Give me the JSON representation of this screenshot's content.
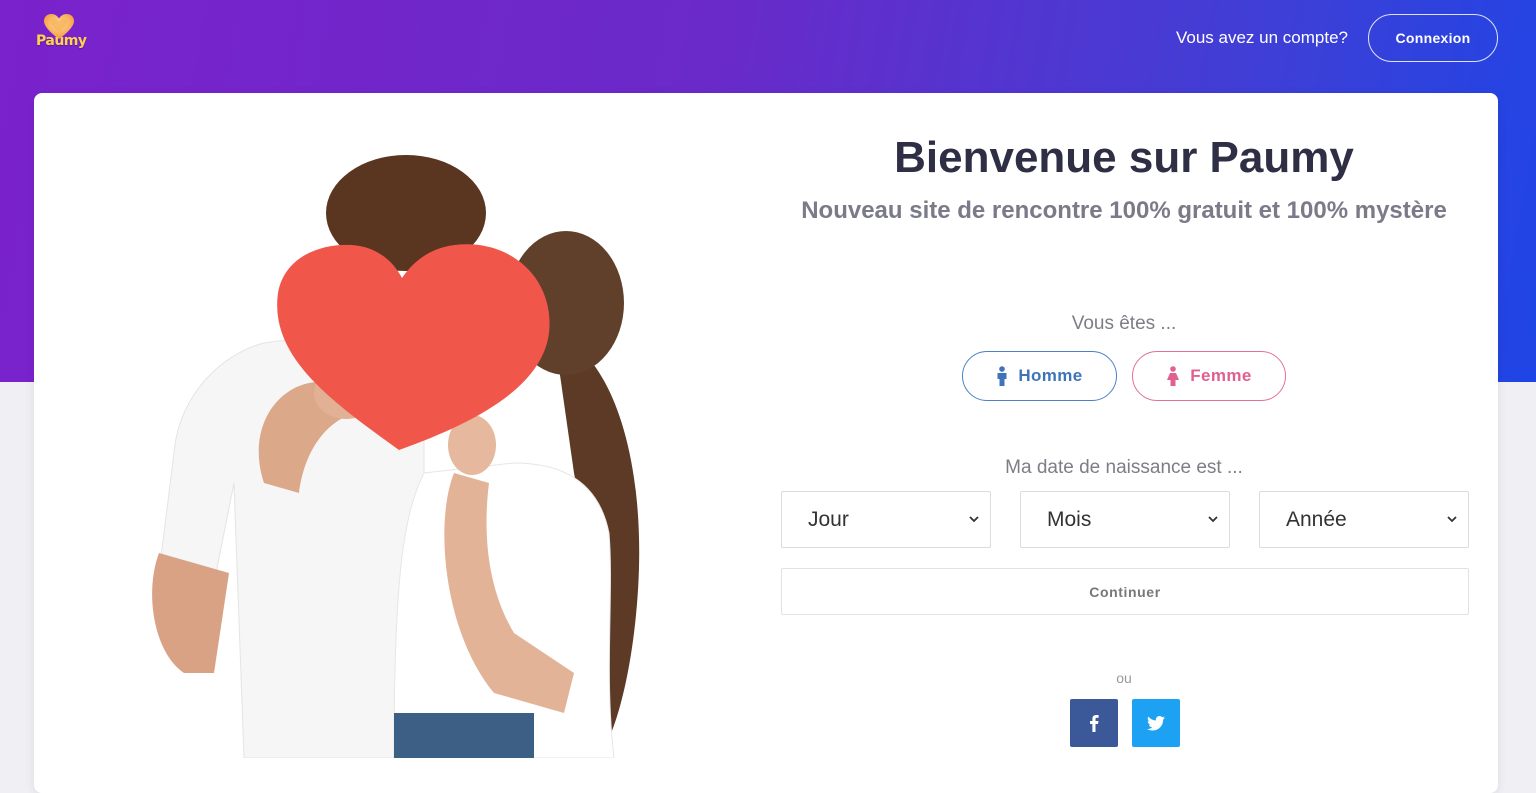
{
  "header": {
    "logo_text": "Paumy",
    "account_question": "Vous avez un compte?",
    "login_label": "Connexion"
  },
  "main": {
    "title": "Bienvenue sur Paumy",
    "subtitle": "Nouveau site de rencontre 100% gratuit et 100% mystère",
    "gender_prompt": "Vous êtes ...",
    "gender_options": [
      {
        "label": "Homme",
        "icon": "male-icon",
        "color": "#3f74b8"
      },
      {
        "label": "Femme",
        "icon": "female-icon",
        "color": "#e0608f"
      }
    ],
    "birthdate_prompt": "Ma date de naissance est ...",
    "birthdate_selects": [
      {
        "value": "Jour"
      },
      {
        "value": "Mois"
      },
      {
        "value": "Année"
      }
    ],
    "continue_label": "Continuer",
    "or_label": "ou",
    "social": [
      {
        "icon": "facebook-icon",
        "color": "#3b5998"
      },
      {
        "icon": "twitter-icon",
        "color": "#1da1f2"
      }
    ]
  },
  "colors": {
    "header_gradient_start": "#7a22cc",
    "header_gradient_end": "#1f45e6",
    "title": "#2e2e44",
    "subtitle": "#7a7a88"
  }
}
